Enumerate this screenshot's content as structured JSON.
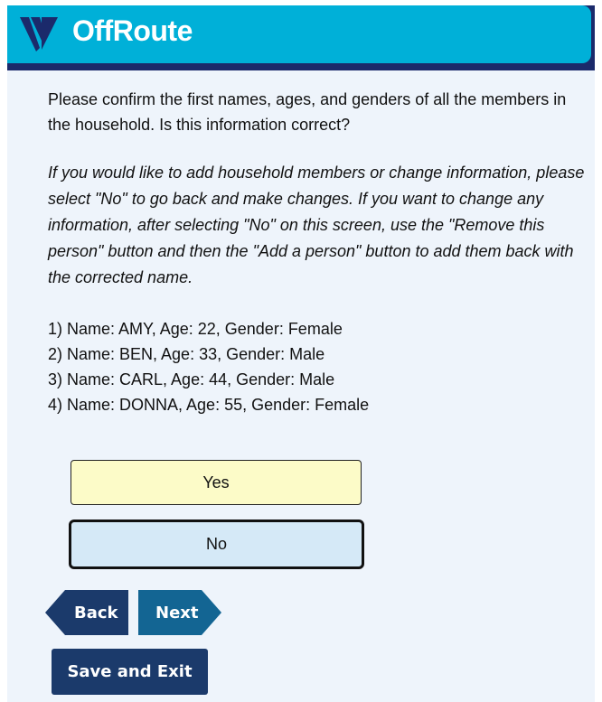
{
  "app": {
    "name": "OffRoute",
    "brand_colors": {
      "header": "#00b0d8",
      "header_shadow": "#1b2a6b",
      "nav_back": "#1b3a6b",
      "nav_next": "#136593",
      "yes_bg": "#fcfbc8",
      "no_bg": "#d5e9f7"
    },
    "logo_icon": "offroute-logo-icon"
  },
  "main": {
    "intro": "Please confirm the first names, ages, and genders of all the members in the household. Is this information correct?",
    "instructions": "If you would like to add household members or change information, please select \"No\" to go back and make changes. If you want to change any information, after selecting \"No\" on this screen, use the \"Remove this person\" button and then the \"Add a person\" button to add them back with the corrected name.",
    "members": [
      "1) Name: AMY, Age: 22, Gender: Female",
      "2) Name: BEN, Age: 33, Gender: Male",
      "3) Name: CARL, Age: 44, Gender: Male",
      "4) Name: DONNA, Age: 55, Gender: Female"
    ],
    "answers": {
      "yes_label": "Yes",
      "no_label": "No"
    }
  },
  "nav": {
    "back_label": "Back",
    "next_label": "Next",
    "save_label": "Save and Exit"
  }
}
